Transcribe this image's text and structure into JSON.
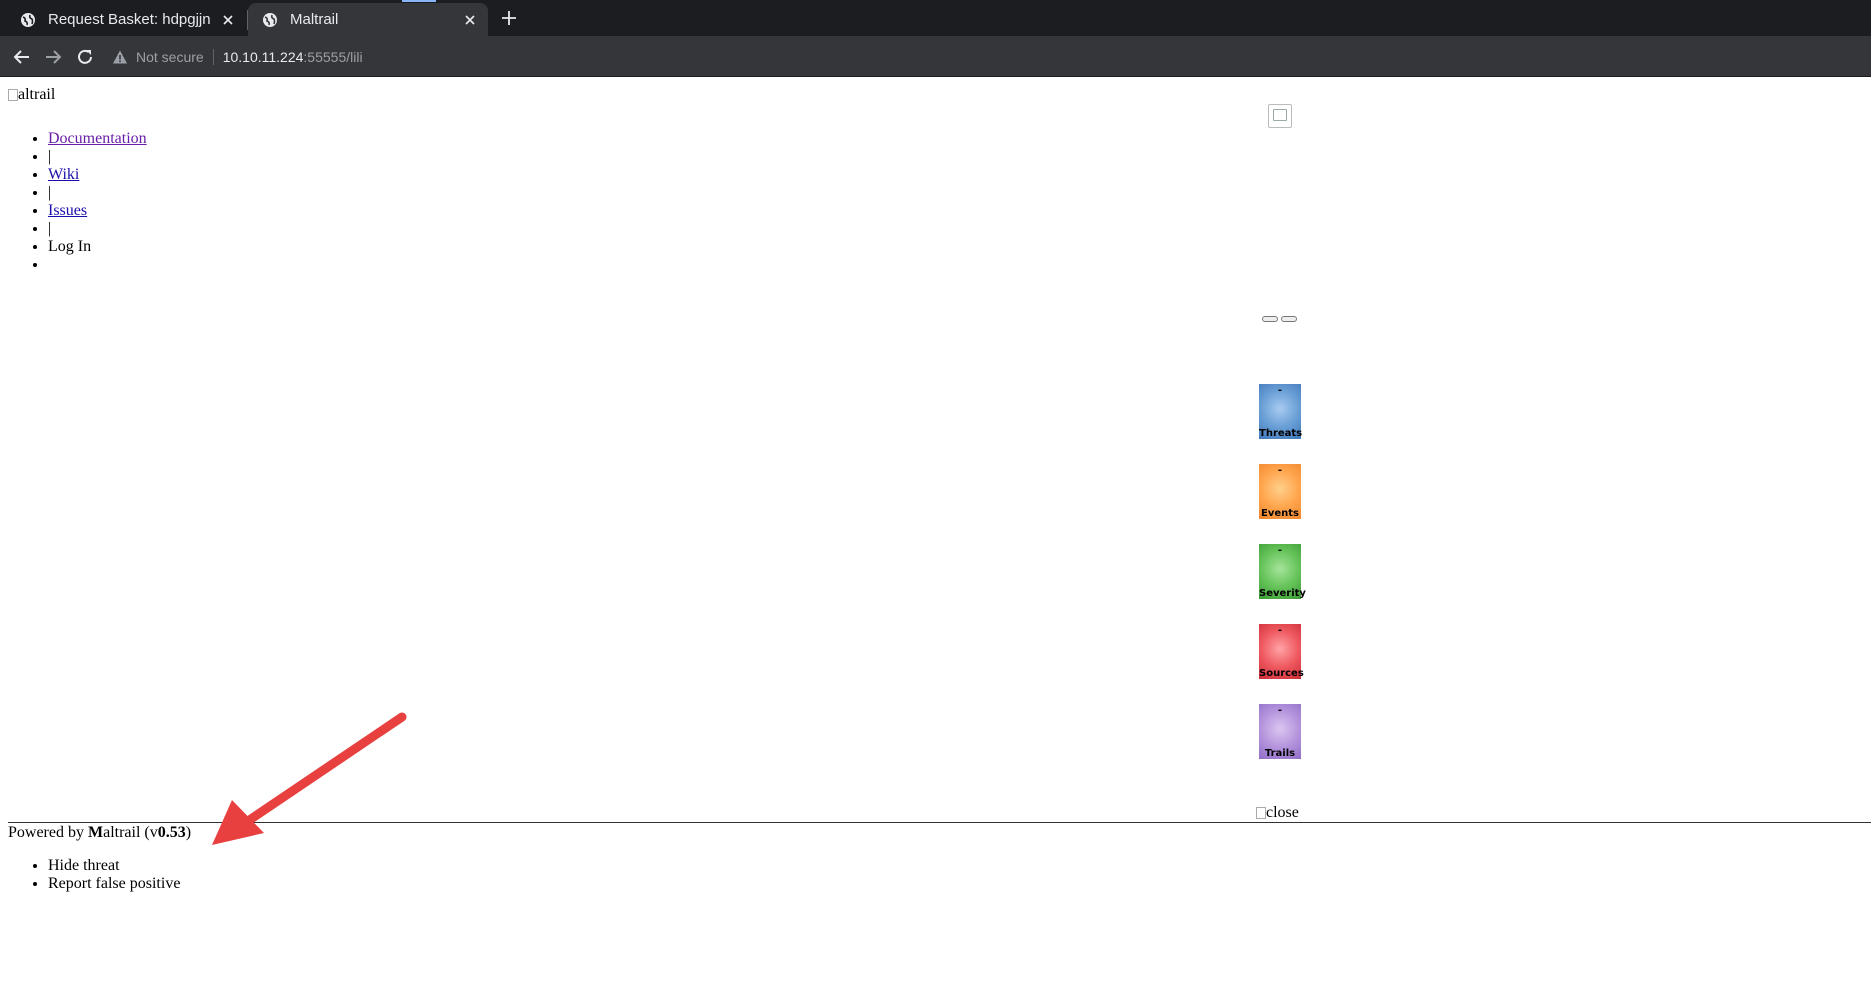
{
  "browser": {
    "tabs": [
      {
        "title": "Request Basket: hdpgjjn",
        "active": false
      },
      {
        "title": "Maltrail",
        "active": true
      }
    ],
    "address": {
      "security_label": "Not secure",
      "host": "10.10.11.224",
      "path": ":55555/lili"
    }
  },
  "page": {
    "logo_alt": "altrail",
    "nav": [
      {
        "label": "Documentation"
      },
      {
        "label": "|"
      },
      {
        "label": "Wiki"
      },
      {
        "label": "|"
      },
      {
        "label": "Issues"
      },
      {
        "label": "|"
      },
      {
        "label": "Log In"
      },
      {
        "label": ""
      }
    ],
    "stats": [
      {
        "value": "-",
        "label": "Threats",
        "color": "#5b8fcc"
      },
      {
        "value": "-",
        "label": "Events",
        "color": "#f99744"
      },
      {
        "value": "-",
        "label": "Severity",
        "color": "#52b448"
      },
      {
        "value": "-",
        "label": "Sources",
        "color": "#e2474e"
      },
      {
        "value": "-",
        "label": "Trails",
        "color": "#a886d4"
      }
    ],
    "close_alt": "close",
    "footer": {
      "prefix": "Powered by ",
      "brand_initial": "M",
      "brand_rest": "altrail",
      "version_open": " (v",
      "version": "0.53",
      "version_close": ")"
    },
    "context_menu": [
      {
        "label": "Hide threat"
      },
      {
        "label": "Report false positive"
      }
    ]
  },
  "annotation": {
    "arrow_color": "#e8403f"
  }
}
